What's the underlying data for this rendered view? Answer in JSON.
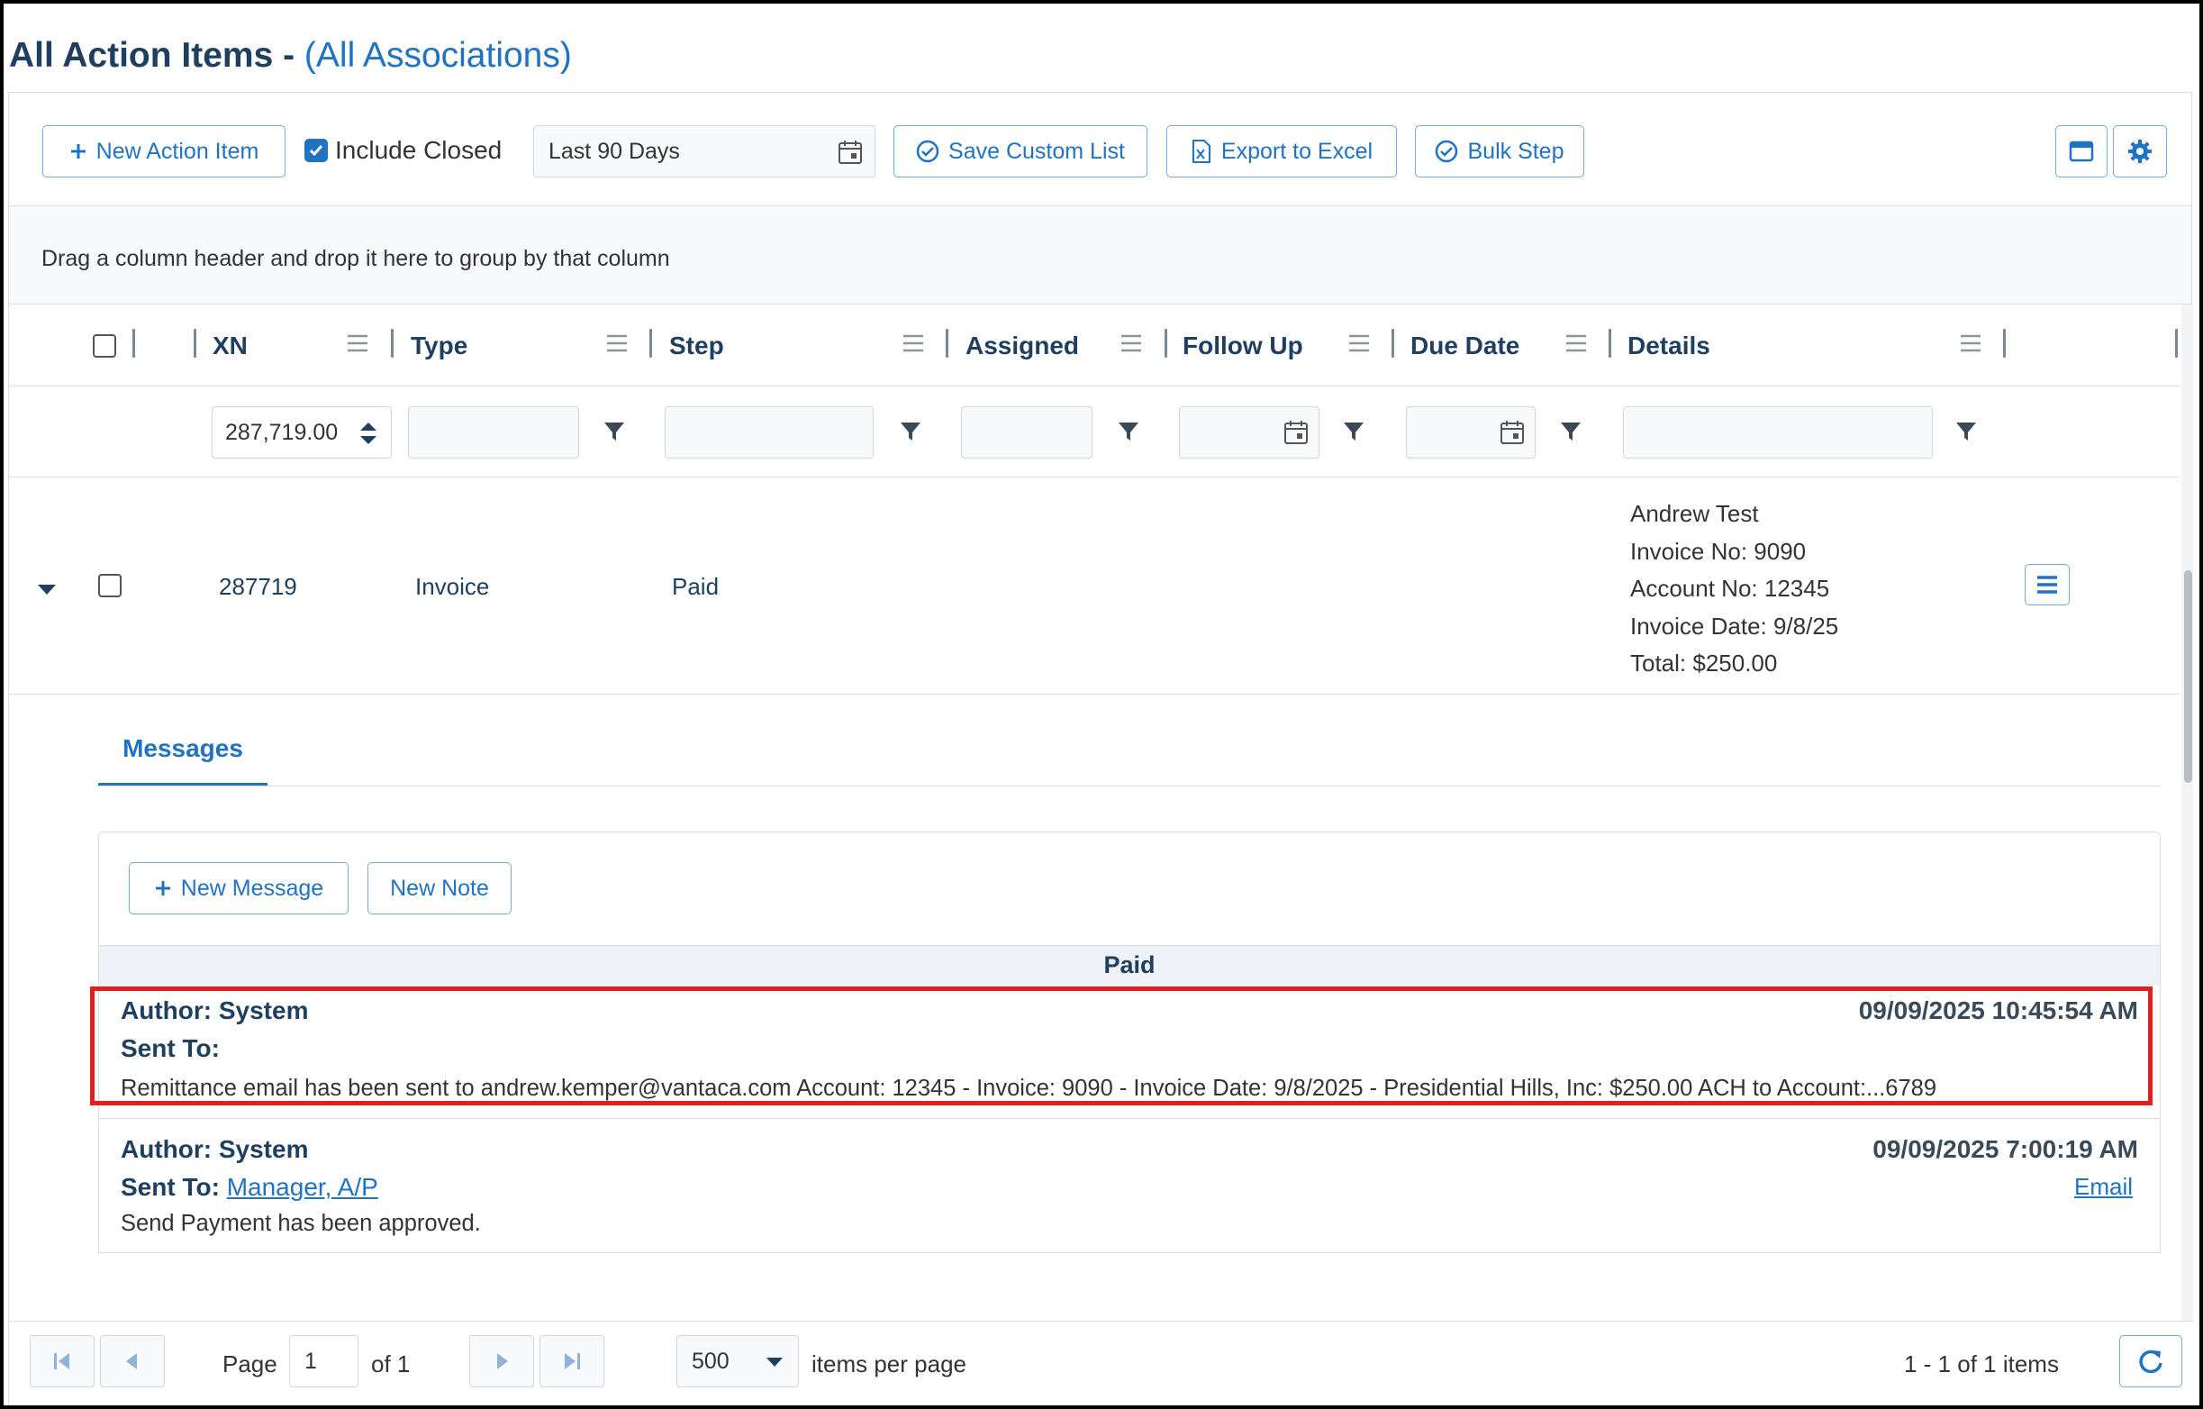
{
  "page": {
    "title": "All Action Items - ",
    "association_link": "(All Associations)"
  },
  "toolbar": {
    "new_action_item": "New Action Item",
    "include_closed": "Include Closed",
    "include_closed_checked": true,
    "date_range": "Last 90 Days",
    "save_custom_list": "Save Custom List",
    "export_to_excel": "Export to Excel",
    "bulk_step": "Bulk Step"
  },
  "group_hint": "Drag a column header and drop it here to group by that column",
  "columns": {
    "xn": "XN",
    "type": "Type",
    "step": "Step",
    "assigned": "Assigned",
    "follow_up": "Follow Up",
    "due_date": "Due Date",
    "details": "Details"
  },
  "filters": {
    "xn_value": "287,719.00"
  },
  "rows": [
    {
      "xn": "287719",
      "type": "Invoice",
      "step": "Paid",
      "assigned": "",
      "follow_up": "",
      "due_date": "",
      "details": [
        "Andrew Test",
        "Invoice No: 9090",
        "Account No: 12345",
        "Invoice Date: 9/8/25",
        "Total: $250.00"
      ]
    }
  ],
  "detail": {
    "tab_label": "Messages",
    "new_message": "New Message",
    "new_note": "New Note",
    "group_header": "Paid",
    "messages": [
      {
        "author": "Author: System",
        "sent_to_label": "Sent To:",
        "sent_to": "",
        "timestamp": "09/09/2025 10:45:54 AM",
        "body": "Remittance email has been sent to andrew.kemper@vantaca.com Account: 12345 - Invoice: 9090 - Invoice Date: 9/8/2025 - Presidential Hills, Inc: $250.00 ACH to Account:...6789",
        "link": ""
      },
      {
        "author": "Author: System",
        "sent_to_label": "Sent To:",
        "sent_to": "Manager, A/P",
        "timestamp": "09/09/2025 7:00:19 AM",
        "body": "Send Payment has been approved.",
        "link": "Email"
      }
    ]
  },
  "pager": {
    "page_label": "Page",
    "page_value": "1",
    "of_label": "of 1",
    "page_size": "500",
    "items_per_page": "items per page",
    "summary": "1 - 1 of 1 items"
  },
  "colors": {
    "primary": "#1f73c2",
    "heading": "#1f3f60",
    "highlight": "#e0201e"
  }
}
